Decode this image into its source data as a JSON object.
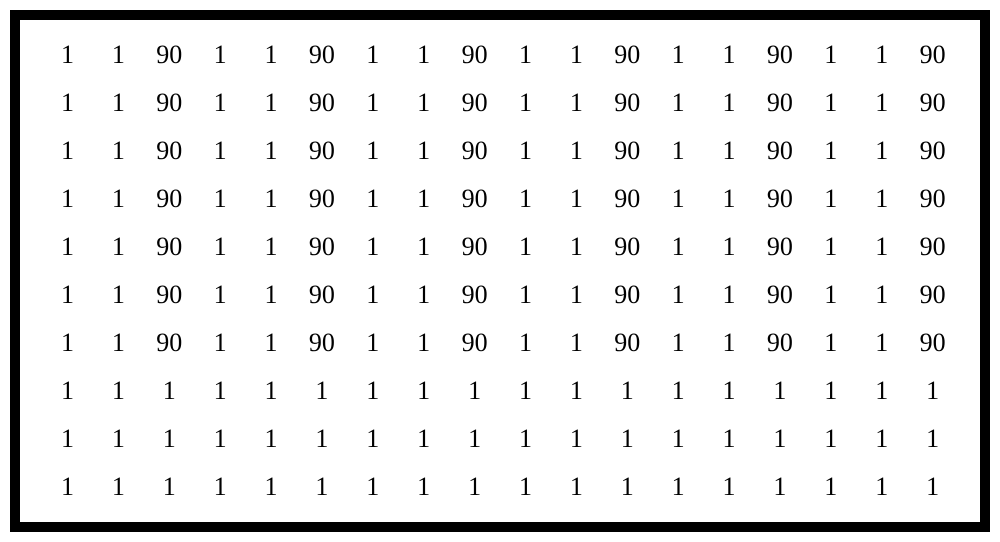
{
  "grid": {
    "rows": [
      [
        "1",
        "1",
        "90",
        "1",
        "1",
        "90",
        "1",
        "1",
        "90",
        "1",
        "1",
        "90",
        "1",
        "1",
        "90",
        "1",
        "1",
        "90"
      ],
      [
        "1",
        "1",
        "90",
        "1",
        "1",
        "90",
        "1",
        "1",
        "90",
        "1",
        "1",
        "90",
        "1",
        "1",
        "90",
        "1",
        "1",
        "90"
      ],
      [
        "1",
        "1",
        "90",
        "1",
        "1",
        "90",
        "1",
        "1",
        "90",
        "1",
        "1",
        "90",
        "1",
        "1",
        "90",
        "1",
        "1",
        "90"
      ],
      [
        "1",
        "1",
        "90",
        "1",
        "1",
        "90",
        "1",
        "1",
        "90",
        "1",
        "1",
        "90",
        "1",
        "1",
        "90",
        "1",
        "1",
        "90"
      ],
      [
        "1",
        "1",
        "90",
        "1",
        "1",
        "90",
        "1",
        "1",
        "90",
        "1",
        "1",
        "90",
        "1",
        "1",
        "90",
        "1",
        "1",
        "90"
      ],
      [
        "1",
        "1",
        "90",
        "1",
        "1",
        "90",
        "1",
        "1",
        "90",
        "1",
        "1",
        "90",
        "1",
        "1",
        "90",
        "1",
        "1",
        "90"
      ],
      [
        "1",
        "1",
        "90",
        "1",
        "1",
        "90",
        "1",
        "1",
        "90",
        "1",
        "1",
        "90",
        "1",
        "1",
        "90",
        "1",
        "1",
        "90"
      ],
      [
        "1",
        "1",
        "1",
        "1",
        "1",
        "1",
        "1",
        "1",
        "1",
        "1",
        "1",
        "1",
        "1",
        "1",
        "1",
        "1",
        "1",
        "1"
      ],
      [
        "1",
        "1",
        "1",
        "1",
        "1",
        "1",
        "1",
        "1",
        "1",
        "1",
        "1",
        "1",
        "1",
        "1",
        "1",
        "1",
        "1",
        "1"
      ],
      [
        "1",
        "1",
        "1",
        "1",
        "1",
        "1",
        "1",
        "1",
        "1",
        "1",
        "1",
        "1",
        "1",
        "1",
        "1",
        "1",
        "1",
        "1"
      ]
    ]
  }
}
